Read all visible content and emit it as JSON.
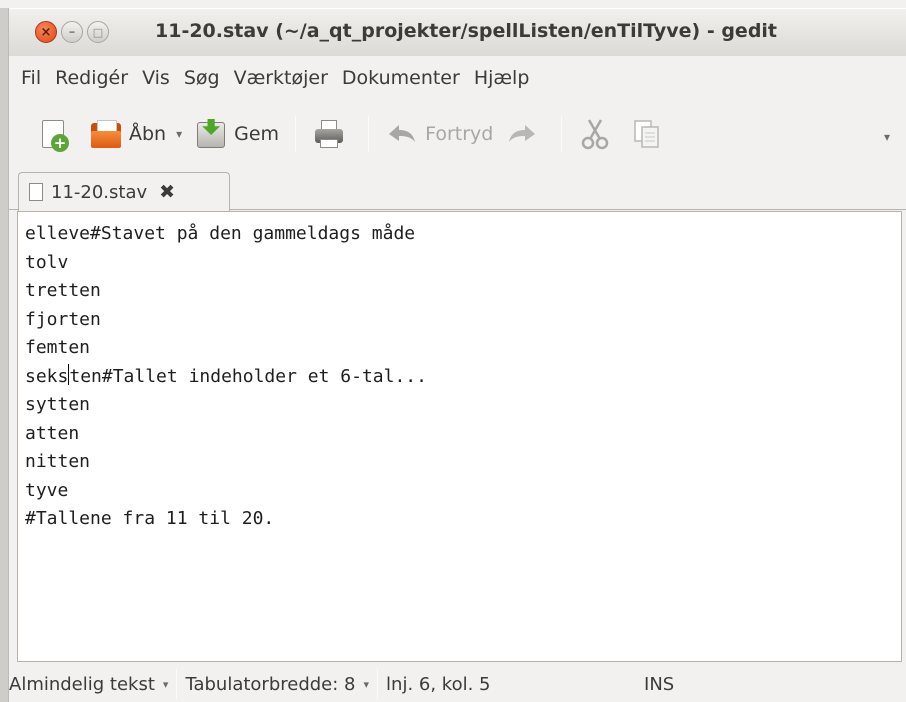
{
  "window": {
    "title": "11-20.stav (~/a_qt_projekter/spellListen/enTilTyve) - gedit",
    "close_symbol": "×",
    "minimize_symbol": "–",
    "maximize_symbol": "□"
  },
  "menubar": {
    "items": [
      "Fil",
      "Redigér",
      "Vis",
      "Søg",
      "Værktøjer",
      "Dokumenter",
      "Hjælp"
    ]
  },
  "toolbar": {
    "new_icon": "new-document-icon",
    "open_label": "Åbn",
    "save_label": "Gem",
    "print_icon": "print-icon",
    "undo_label": "Fortryd",
    "redo_icon": "redo-icon",
    "cut_icon": "cut-icon",
    "copy_icon": "copy-icon",
    "dropdown_symbol": "▾"
  },
  "tab": {
    "label": "11-20.stav",
    "close_symbol": "✖"
  },
  "editor": {
    "lines": [
      "elleve#Stavet på den gammeldags måde",
      "tolv",
      "tretten",
      "fjorten",
      "femten",
      "seksten#Tallet indeholder et 6-tal...",
      "sytten",
      "atten",
      "nitten",
      "tyve",
      "#Tallene fra 11 til 20."
    ],
    "caret": {
      "line": 6,
      "column": 5
    }
  },
  "statusbar": {
    "language": "Almindelig tekst",
    "tab_width": "Tabulatorbredde: 8",
    "position": "lnj. 6, kol. 5",
    "mode": "INS",
    "dropdown_symbol": "▾"
  },
  "colors": {
    "accent_close": "#dd4814",
    "window_bg": "#f2f1f0",
    "editor_bg": "#ffffff"
  }
}
